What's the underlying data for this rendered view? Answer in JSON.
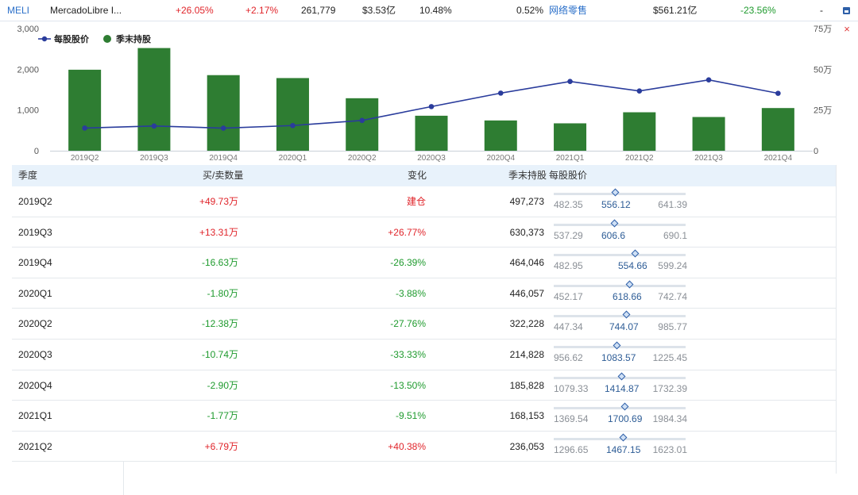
{
  "header": {
    "ticker": "MELI",
    "name": "MercadoLibre I...",
    "change_pct": "+26.05%",
    "change2": "+2.17%",
    "holders": "261,779",
    "value": "$3.53亿",
    "pct1": "10.48%",
    "pct2": "0.52%",
    "industry": "网络零售",
    "mktcap": "$561.21亿",
    "ytd": "-23.56%",
    "dash": "-"
  },
  "legend": {
    "price": "每股股价",
    "holding": "季末持股"
  },
  "axes": {
    "left_ticks": [
      "3,000",
      "2,000",
      "1,000",
      "0"
    ],
    "right_ticks": [
      "75万",
      "50万",
      "25万",
      "0"
    ]
  },
  "colors": {
    "bar": "#2e7d32",
    "line": "#2a3c9c",
    "header_bg": "#e8f2fb"
  },
  "chart_data": {
    "type": "bar",
    "categories": [
      "2019Q2",
      "2019Q3",
      "2019Q4",
      "2020Q1",
      "2020Q2",
      "2020Q3",
      "2020Q4",
      "2021Q1",
      "2021Q2",
      "2021Q3",
      "2021Q4"
    ],
    "series": [
      {
        "name": "季末持股",
        "type": "bar",
        "axis": "right",
        "values": [
          497273,
          630373,
          464046,
          446057,
          322228,
          214828,
          185828,
          168153,
          236053,
          207000,
          262000
        ]
      },
      {
        "name": "每股股价",
        "type": "line",
        "axis": "left",
        "values": [
          556.12,
          606.6,
          554.66,
          618.66,
          744.07,
          1083.57,
          1414.87,
          1700.69,
          1467.15,
          1740,
          1410
        ]
      }
    ],
    "left_ylim": [
      0,
      3000
    ],
    "right_ylim": [
      0,
      750000
    ],
    "grid": false,
    "legend": "top-left"
  },
  "table": {
    "headers": {
      "quarter": "季度",
      "trade": "买/卖数量",
      "change": "变化",
      "holding": "季末持股",
      "price": "每股股价"
    },
    "rows": [
      {
        "q": "2019Q2",
        "trade": "+49.73万",
        "change": "建仓",
        "hold": "497,273",
        "lo": "482.35",
        "mid": "556.12",
        "hi": "641.39",
        "dir": "pos"
      },
      {
        "q": "2019Q3",
        "trade": "+13.31万",
        "change": "+26.77%",
        "hold": "630,373",
        "lo": "537.29",
        "mid": "606.6",
        "hi": "690.1",
        "dir": "pos"
      },
      {
        "q": "2019Q4",
        "trade": "-16.63万",
        "change": "-26.39%",
        "hold": "464,046",
        "lo": "482.95",
        "mid": "554.66",
        "hi": "599.24",
        "dir": "neg"
      },
      {
        "q": "2020Q1",
        "trade": "-1.80万",
        "change": "-3.88%",
        "hold": "446,057",
        "lo": "452.17",
        "mid": "618.66",
        "hi": "742.74",
        "dir": "neg"
      },
      {
        "q": "2020Q2",
        "trade": "-12.38万",
        "change": "-27.76%",
        "hold": "322,228",
        "lo": "447.34",
        "mid": "744.07",
        "hi": "985.77",
        "dir": "neg"
      },
      {
        "q": "2020Q3",
        "trade": "-10.74万",
        "change": "-33.33%",
        "hold": "214,828",
        "lo": "956.62",
        "mid": "1083.57",
        "hi": "1225.45",
        "dir": "neg"
      },
      {
        "q": "2020Q4",
        "trade": "-2.90万",
        "change": "-13.50%",
        "hold": "185,828",
        "lo": "1079.33",
        "mid": "1414.87",
        "hi": "1732.39",
        "dir": "neg"
      },
      {
        "q": "2021Q1",
        "trade": "-1.77万",
        "change": "-9.51%",
        "hold": "168,153",
        "lo": "1369.54",
        "mid": "1700.69",
        "hi": "1984.34",
        "dir": "neg"
      },
      {
        "q": "2021Q2",
        "trade": "+6.79万",
        "change": "+40.38%",
        "hold": "236,053",
        "lo": "1296.65",
        "mid": "1467.15",
        "hi": "1623.01",
        "dir": "pos"
      }
    ]
  }
}
